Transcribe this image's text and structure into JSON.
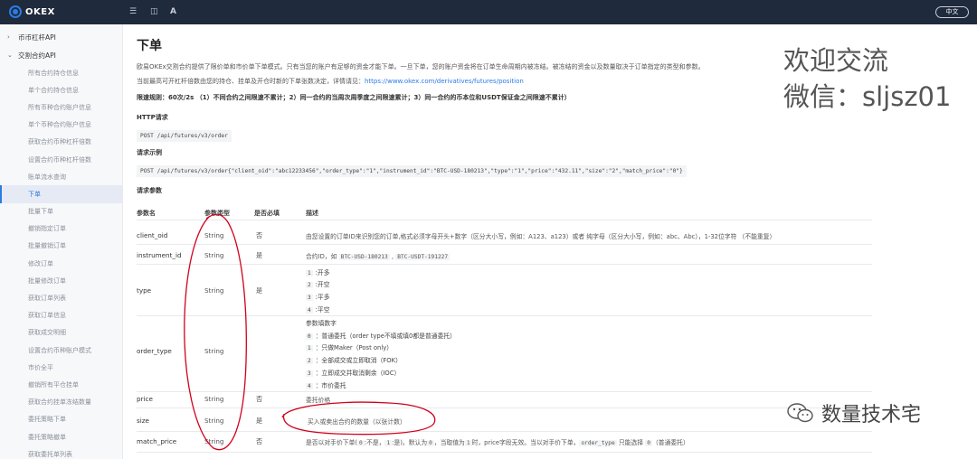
{
  "topbar": {
    "brand": "OKEX",
    "icons": [
      "menu-icon",
      "grid-icon",
      "font-icon"
    ],
    "font_glyph": "A",
    "lang_button": "中文"
  },
  "sidebar": {
    "groups": [
      {
        "label": "币币杠杆API",
        "expanded": false
      },
      {
        "label": "交割合约API",
        "expanded": true
      }
    ],
    "items": [
      "所有合约持仓信息",
      "单个合约持仓信息",
      "所有币种合约账户信息",
      "单个币种合约账户信息",
      "获取合约币种杠杆倍数",
      "设置合约币种杠杆倍数",
      "账单流水查询",
      "下单",
      "批量下单",
      "撤销指定订单",
      "批量撤销订单",
      "修改订单",
      "批量修改订单",
      "获取订单列表",
      "获取订单信息",
      "获取成交明细",
      "设置合约币种账户模式",
      "市价全平",
      "撤销所有平仓挂单",
      "获取合约挂单冻结数量",
      "委托策略下单",
      "委托策略撤单",
      "获取委托单列表"
    ],
    "active_index": 7
  },
  "main": {
    "title": "下单",
    "intro": "欧易OKEx交割合约提供了限价单和市价单下单模式。只有当您的账户有足够的资金才能下单。一旦下单，您的账户资金将在订单生命周期内被冻结。被冻结的资金以及数量取决于订单指定的类型和参数。",
    "leverage_text": "当前最高可开杠杆倍数由您的持仓、挂单及开仓时新的下单张数决定，详情请见：",
    "leverage_link": "https://www.okex.com/derivatives/futures/position",
    "rate_limit": "限速规则：60次/2s （1）不同合约之间限速不累计；2）同一合约的当周次周季度之间限速累计；3）同一合约的币本位和USDT保证金之间限速不累计）",
    "http_heading": "HTTP请求",
    "http_code": "POST /api/futures/v3/order",
    "example_heading": "请求示例",
    "example_code": "POST /api/futures/v3/order{\"client_oid\":\"abc12233456\",\"order_type\":\"1\",\"instrument_id\":\"BTC-USD-180213\",\"type\":\"1\",\"price\":\"432.11\",\"size\":\"2\",\"match_price\":\"0\"}",
    "params_heading": "请求参数",
    "table": {
      "headers": [
        "参数名",
        "参数类型",
        "是否必填",
        "描述"
      ],
      "rows": [
        {
          "name": "client_oid",
          "type": "String",
          "required": "否",
          "desc": "由您设置的订单ID来识别您的订单,格式必须字母开头+数字（区分大小写，例如：A123、a123）或者 纯字母（区分大小写，例如：abc、Abc），1-32位字符 （不能重复）"
        },
        {
          "name": "instrument_id",
          "type": "String",
          "required": "是",
          "desc": "合约ID，如",
          "codes": [
            "BTC-USD-180213",
            "BTC-USDT-191227"
          ]
        },
        {
          "name": "type",
          "type": "String",
          "required": "是",
          "enum": [
            [
              "1",
              ":开多"
            ],
            [
              "2",
              ":开空"
            ],
            [
              "3",
              ":平多"
            ],
            [
              "4",
              ":平空"
            ]
          ]
        },
        {
          "name": "order_type",
          "type": "String",
          "required": "",
          "desc": "参数填数字",
          "enum": [
            [
              "0",
              "：普通委托（order type不填或填0都是普通委托）"
            ],
            [
              "1",
              "：只做Maker（Post only）"
            ],
            [
              "2",
              "：全部成交或立即取消（FOK）"
            ],
            [
              "3",
              "：立即成交并取消剩余（IOC）"
            ],
            [
              "4",
              "：市价委托"
            ]
          ]
        },
        {
          "name": "price",
          "type": "String",
          "required": "否",
          "desc": "委托价格"
        },
        {
          "name": "size",
          "type": "String",
          "required": "是",
          "desc": "买入或卖出合约的数量（以张计数）"
        },
        {
          "name": "match_price",
          "type": "String",
          "required": "否",
          "desc_parts": [
            "是否以对手价下单(",
            "0",
            ":不是，",
            "1",
            ":是)。默认为",
            "0",
            "，当取值为",
            "1",
            "时，price字段无效。当以对手价下单，",
            "order_type",
            "只能选择",
            "0",
            "（普通委托）"
          ]
        }
      ]
    }
  },
  "watermark": {
    "line1": "欢迎交流",
    "line2": "微信：sljsz01",
    "account": "数量技术宅"
  },
  "colors": {
    "topbar": "#1f2a3d",
    "accent": "#2c7be5",
    "annotation": "#d0021b"
  }
}
